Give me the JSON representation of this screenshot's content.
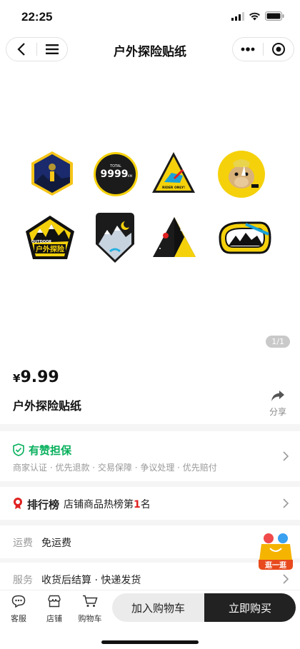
{
  "status": {
    "time": "22:25"
  },
  "nav": {
    "title": "户外探险贴纸"
  },
  "stickers": [
    {
      "name": "sticker-mountain-hexagon",
      "text": ""
    },
    {
      "name": "sticker-9999km",
      "text": "9999",
      "sub": "TOTAL",
      "unit": "KM"
    },
    {
      "name": "sticker-rider-triangle",
      "text": "RIDER ONLY!"
    },
    {
      "name": "sticker-rhino-circle",
      "text": ""
    },
    {
      "name": "sticker-outdoor-pentagon",
      "text": "户外探险",
      "sub": "OUTDOOR"
    },
    {
      "name": "sticker-night-mountain",
      "text": ""
    },
    {
      "name": "sticker-pyramid",
      "text": ""
    },
    {
      "name": "sticker-carabiner",
      "text": ""
    }
  ],
  "gallery": {
    "page_indicator": "1/1"
  },
  "product": {
    "currency": "¥",
    "price": "9.99",
    "title": "户外探险贴纸",
    "share_label": "分享"
  },
  "guarantee": {
    "title": "有赞担保",
    "subtitle": "商家认证 · 优先退款 · 交易保障 · 争议处理 · 优先赔付"
  },
  "ranking": {
    "label": "排行榜",
    "text_before": "店铺商品热榜第",
    "rank": "1",
    "text_after": "名"
  },
  "shipping": {
    "label": "运费",
    "value": "免运费"
  },
  "service": {
    "label": "服务",
    "value": "收货后结算 · 快递发货"
  },
  "float_badge": {
    "label": "逛一逛"
  },
  "bottom_bar": {
    "service_label": "客服",
    "shop_label": "店铺",
    "cart_label": "购物车",
    "add_to_cart": "加入购物车",
    "buy_now": "立即购买"
  },
  "colors": {
    "accent_green": "#07b05c",
    "rank_red": "#e02020",
    "sticker_yellow": "#f5d10b",
    "dark": "#222222"
  }
}
